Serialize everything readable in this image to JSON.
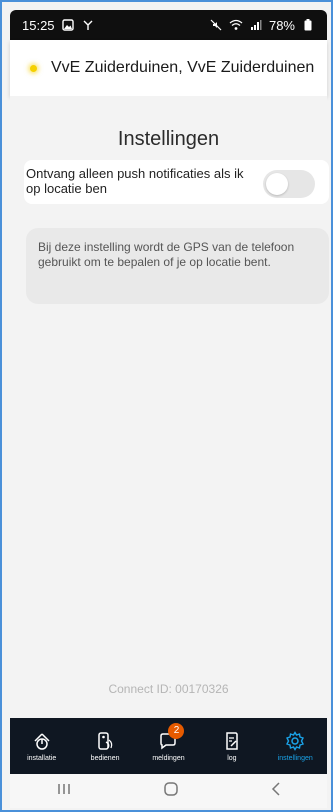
{
  "status_bar": {
    "time": "15:25",
    "battery": "78%"
  },
  "header": {
    "title": "VvE Zuiderduinen, VvE Zuiderduinen",
    "accent_color": "#f5d000"
  },
  "settings": {
    "page_title": "Instellingen",
    "push_toggle_label": "Ontvang alleen push notificaties als ik op locatie ben",
    "push_toggle_on": false,
    "info_text": "Bij deze instelling wordt de GPS van de telefoon gebruikt om te bepalen of je op locatie bent.",
    "connect_id": "Connect ID: 00170326"
  },
  "bottom_nav": {
    "items": [
      {
        "label": "installatie",
        "icon": "installation-icon",
        "active": false
      },
      {
        "label": "bedienen",
        "icon": "remote-control-icon",
        "active": false
      },
      {
        "label": "meldingen",
        "icon": "chat-bubble-icon",
        "active": false,
        "badge": "2"
      },
      {
        "label": "log",
        "icon": "document-edit-icon",
        "active": false
      },
      {
        "label": "instellingen",
        "icon": "gear-icon",
        "active": true
      }
    ],
    "active_color": "#1aa3e8"
  }
}
